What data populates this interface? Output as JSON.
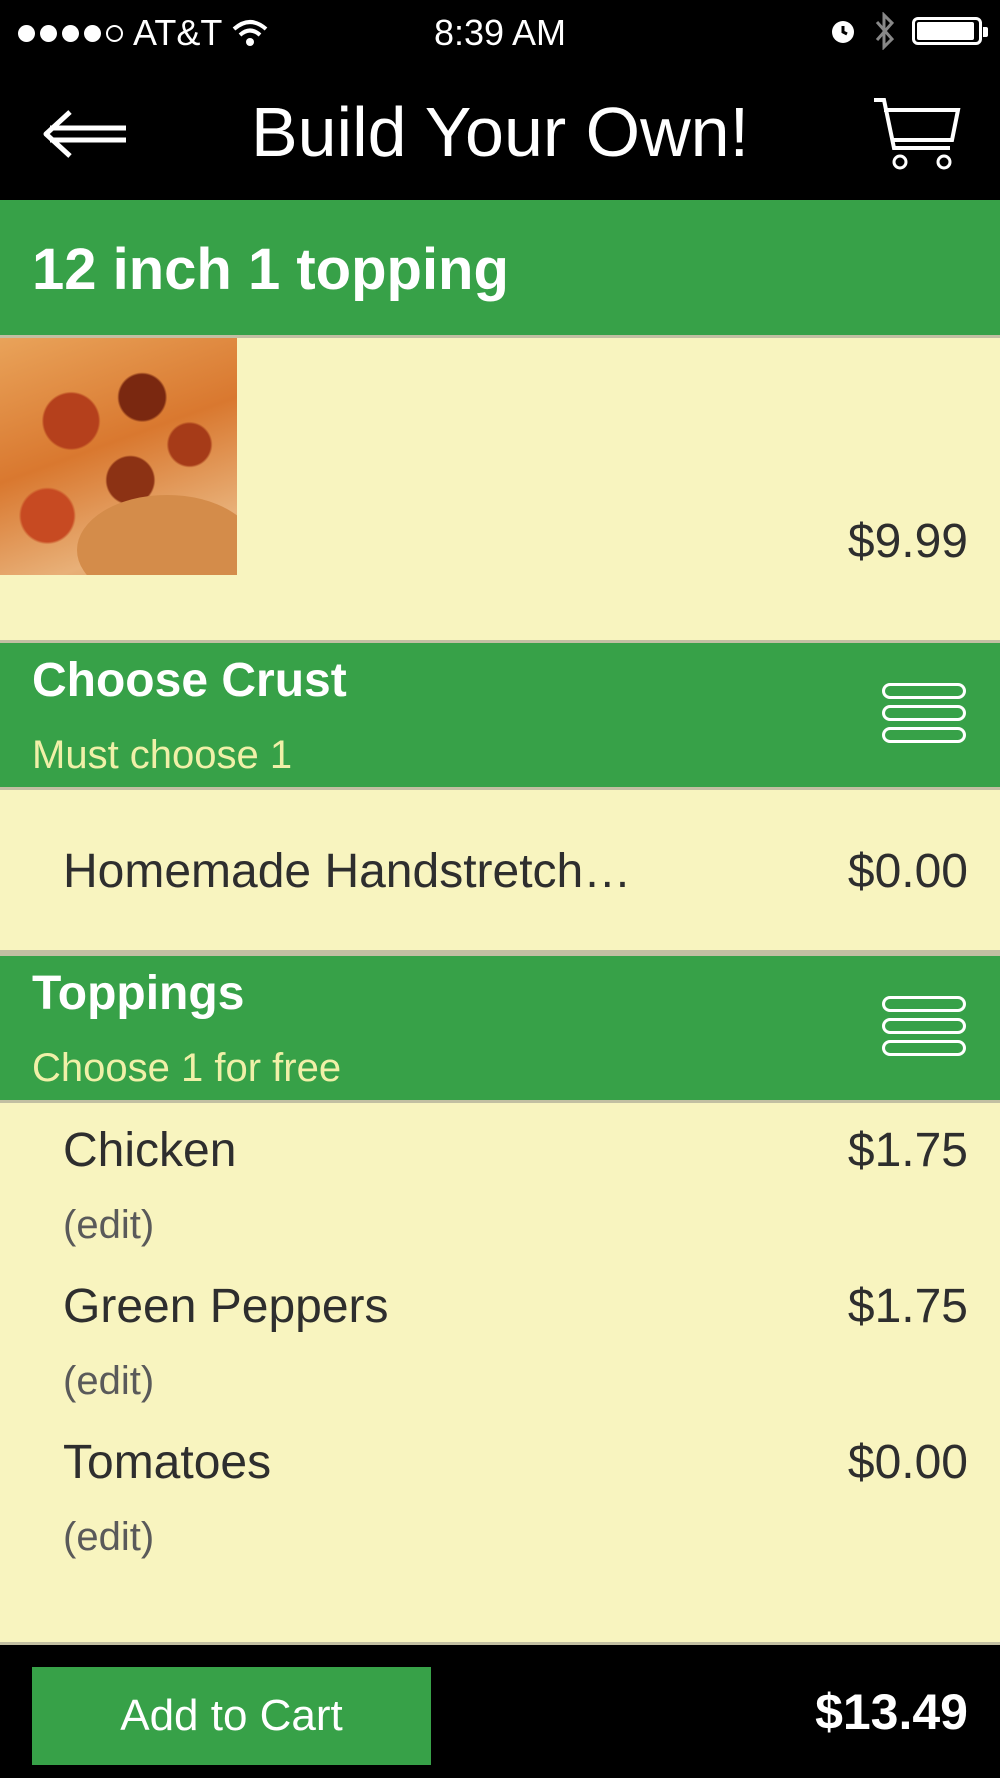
{
  "status_bar": {
    "carrier": "AT&T",
    "time": "8:39 AM",
    "signal_bars": 4,
    "signal_total": 5,
    "battery_level": 0.95
  },
  "nav": {
    "title": "Build Your Own!",
    "back_icon": "back-arrow-icon",
    "cart_icon": "cart-icon"
  },
  "product": {
    "title": "12 inch 1 topping",
    "price": "$9.99"
  },
  "crust_section": {
    "title": "Choose Crust",
    "subtitle": "Must choose 1",
    "options": [
      {
        "name": "Homemade Handstretch…",
        "price": "$0.00"
      }
    ]
  },
  "toppings_section": {
    "title": "Toppings",
    "subtitle": "Choose 1 for free",
    "items": [
      {
        "name": "Chicken",
        "price": "$1.75",
        "edit": "(edit)"
      },
      {
        "name": "Green Peppers",
        "price": "$1.75",
        "edit": "(edit)"
      },
      {
        "name": "Tomatoes",
        "price": "$0.00",
        "edit": "(edit)"
      }
    ]
  },
  "footer": {
    "add_label": "Add to Cart",
    "total": "$13.49"
  },
  "colors": {
    "accent_green": "#37a148",
    "background": "#f8f4bf",
    "subtitle_yellow": "#f0f0a8"
  }
}
